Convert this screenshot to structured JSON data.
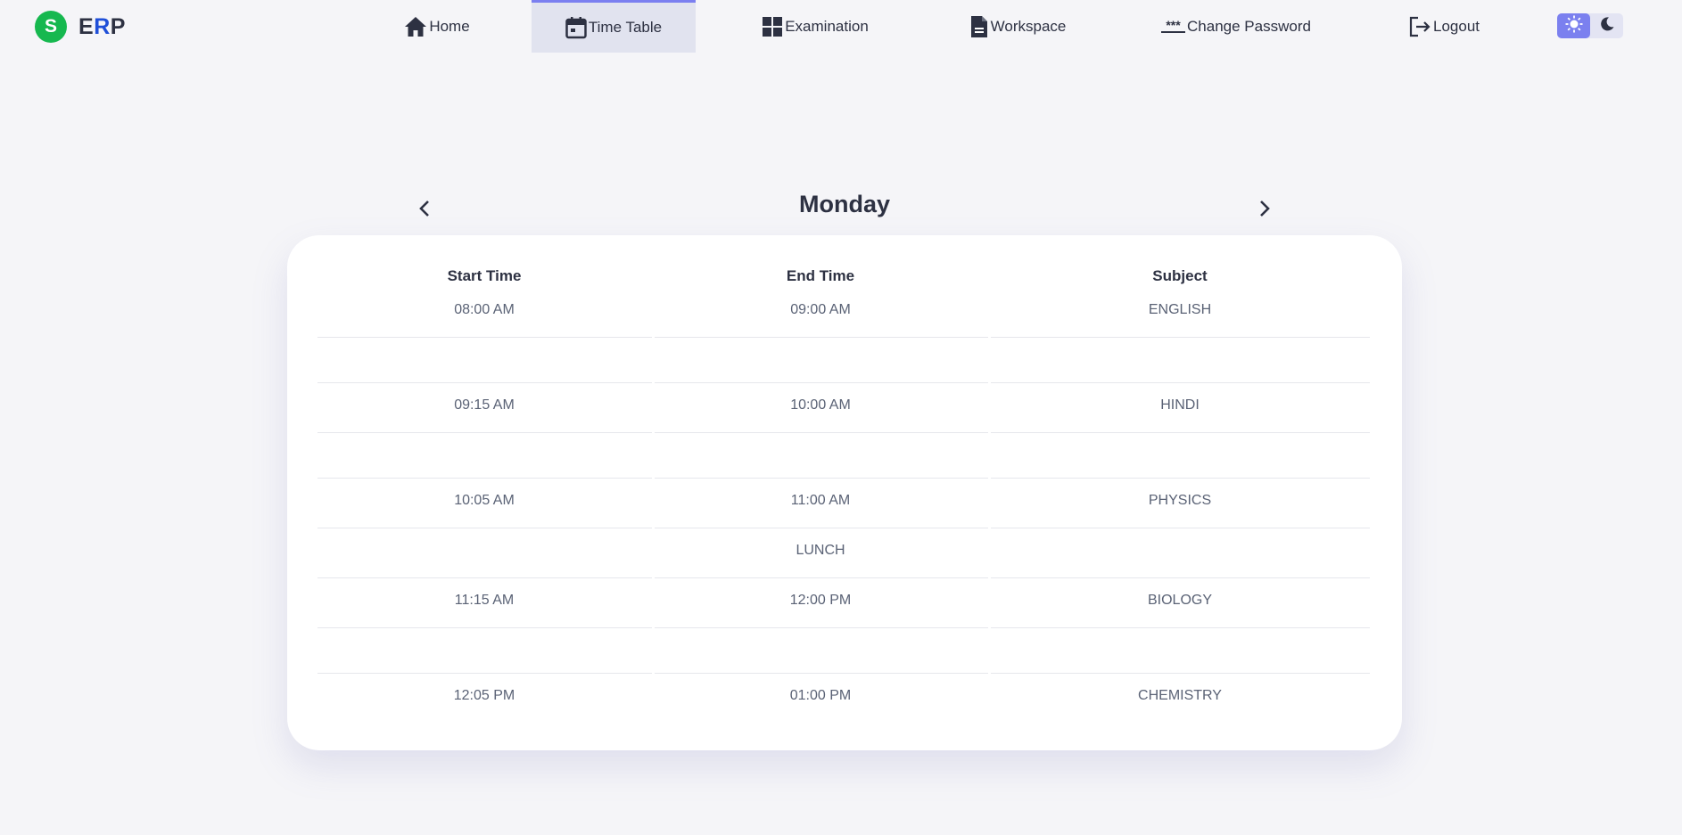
{
  "brand": {
    "logo_letter": "S",
    "name_e": "E",
    "name_r": "R",
    "name_p": "P"
  },
  "nav": [
    {
      "label": "Home",
      "icon": "home-icon"
    },
    {
      "label": "Time Table",
      "icon": "calendar-icon",
      "active": true
    },
    {
      "label": "Examination",
      "icon": "grid-icon"
    },
    {
      "label": "Workspace",
      "icon": "document-icon"
    },
    {
      "label": "Change Password",
      "icon": "password-icon",
      "icon_text": "***"
    },
    {
      "label": "Logout",
      "icon": "logout-icon"
    }
  ],
  "theme": {
    "light_icon": "sun-icon",
    "dark_icon": "moon-icon",
    "selected": "light"
  },
  "timetable": {
    "day": "Monday",
    "columns": {
      "start": "Start Time",
      "end": "End Time",
      "subject": "Subject"
    },
    "rows": [
      {
        "start": "08:00 AM",
        "end": "09:00 AM",
        "subject": "ENGLISH"
      },
      {
        "start": "",
        "end": "",
        "subject": ""
      },
      {
        "start": "09:15 AM",
        "end": "10:00 AM",
        "subject": "HINDI"
      },
      {
        "start": "",
        "end": "",
        "subject": ""
      },
      {
        "start": "10:05 AM",
        "end": "11:00 AM",
        "subject": "PHYSICS"
      },
      {
        "start": "",
        "end": "LUNCH",
        "subject": ""
      },
      {
        "start": "11:15 AM",
        "end": "12:00 PM",
        "subject": "BIOLOGY"
      },
      {
        "start": "",
        "end": "",
        "subject": ""
      },
      {
        "start": "12:05 PM",
        "end": "01:00 PM",
        "subject": "CHEMISTRY"
      }
    ]
  },
  "colors": {
    "accent": "#7b7ff0",
    "brand_green": "#16b84f",
    "brand_blue": "#1f4fd8",
    "text": "#2d3142"
  }
}
